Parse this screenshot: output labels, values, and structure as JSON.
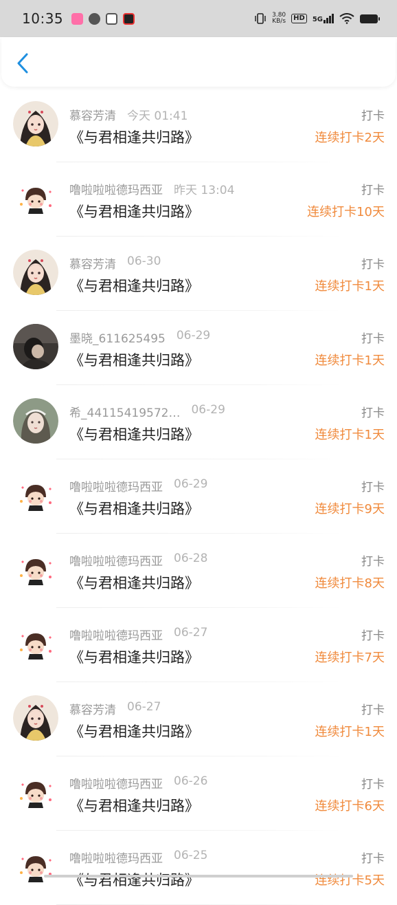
{
  "status_bar": {
    "time": "10:35",
    "net_speed_value": "3.80",
    "net_speed_unit": "KB/s",
    "hd_label": "HD",
    "network_label": "5G",
    "app_icons": [
      "app-icon-pink",
      "app-icon-leaf",
      "app-icon-camera",
      "app-icon-video"
    ]
  },
  "nav": {
    "back_icon": "chevron-left-icon",
    "accent_color": "#1e8fe0"
  },
  "colors": {
    "name": "#9a9a9a",
    "title": "#222222",
    "streak": "#f08a3c"
  },
  "rows": [
    {
      "user": "慕容芳清",
      "time": "今天 01:41",
      "title": "《与君相逢共归路》",
      "action": "打卡",
      "streak": "连续打卡2天",
      "avatar": "girl"
    },
    {
      "user": "噜啦啦啦德玛西亚",
      "time": "昨天 13:04",
      "title": "《与君相逢共归路》",
      "action": "打卡",
      "streak": "连续打卡10天",
      "avatar": "cartoon"
    },
    {
      "user": "慕容芳清",
      "time": "06-30",
      "title": "《与君相逢共归路》",
      "action": "打卡",
      "streak": "连续打卡1天",
      "avatar": "girl"
    },
    {
      "user": "墨晓_611625495",
      "time": "06-29",
      "title": "《与君相逢共归路》",
      "action": "打卡",
      "streak": "连续打卡1天",
      "avatar": "dark"
    },
    {
      "user": "希_44115419572…",
      "time": "06-29",
      "title": "《与君相逢共归路》",
      "action": "打卡",
      "streak": "连续打卡1天",
      "avatar": "green"
    },
    {
      "user": "噜啦啦啦德玛西亚",
      "time": "06-29",
      "title": "《与君相逢共归路》",
      "action": "打卡",
      "streak": "连续打卡9天",
      "avatar": "cartoon"
    },
    {
      "user": "噜啦啦啦德玛西亚",
      "time": "06-28",
      "title": "《与君相逢共归路》",
      "action": "打卡",
      "streak": "连续打卡8天",
      "avatar": "cartoon"
    },
    {
      "user": "噜啦啦啦德玛西亚",
      "time": "06-27",
      "title": "《与君相逢共归路》",
      "action": "打卡",
      "streak": "连续打卡7天",
      "avatar": "cartoon"
    },
    {
      "user": "慕容芳清",
      "time": "06-27",
      "title": "《与君相逢共归路》",
      "action": "打卡",
      "streak": "连续打卡1天",
      "avatar": "girl"
    },
    {
      "user": "噜啦啦啦德玛西亚",
      "time": "06-26",
      "title": "《与君相逢共归路》",
      "action": "打卡",
      "streak": "连续打卡6天",
      "avatar": "cartoon"
    },
    {
      "user": "噜啦啦啦德玛西亚",
      "time": "06-25",
      "title": "《与君相逢共归路》",
      "action": "打卡",
      "streak": "连续打卡5天",
      "avatar": "cartoon"
    }
  ]
}
